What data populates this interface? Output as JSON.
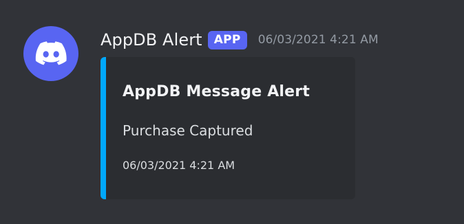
{
  "message": {
    "author": "AppDB Alert",
    "badge": "APP",
    "timestamp": "06/03/2021 4:21 AM",
    "avatar_icon": "discord-logo-icon"
  },
  "embed": {
    "title": "AppDB Message Alert",
    "description": "Purchase Captured",
    "footer_timestamp": "06/03/2021 4:21 AM",
    "accent_color": "#00a8fc"
  },
  "colors": {
    "background": "#313338",
    "embed_background": "#2b2d31",
    "blurple": "#5865F2"
  }
}
